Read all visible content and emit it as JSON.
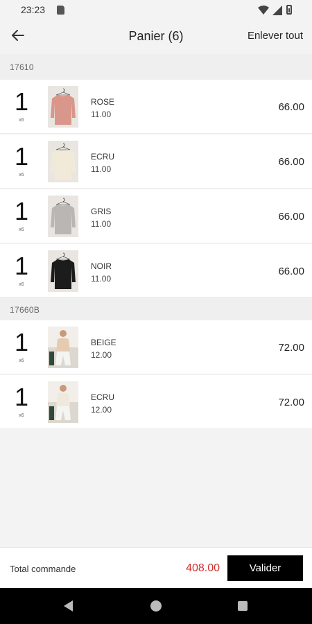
{
  "status_bar": {
    "time": "23:23"
  },
  "app_bar": {
    "title": "Panier (6)",
    "remove_all": "Enlever tout"
  },
  "groups": [
    {
      "ref": "17610"
    },
    {
      "ref": "17660B"
    }
  ],
  "items": [
    {
      "qty": "1",
      "qty_unit": "x6",
      "color": "ROSE",
      "unit_price": "11.00",
      "total": "66.00",
      "swatch": "#d9968a",
      "kind": "sweater"
    },
    {
      "qty": "1",
      "qty_unit": "x6",
      "color": "ECRU",
      "unit_price": "11.00",
      "total": "66.00",
      "swatch": "#f1ead8",
      "kind": "sweater"
    },
    {
      "qty": "1",
      "qty_unit": "x6",
      "color": "GRIS",
      "unit_price": "11.00",
      "total": "66.00",
      "swatch": "#b8b7b3",
      "kind": "sweater"
    },
    {
      "qty": "1",
      "qty_unit": "x6",
      "color": "NOIR",
      "unit_price": "11.00",
      "total": "66.00",
      "swatch": "#1c1c1c",
      "kind": "sweater"
    },
    {
      "qty": "1",
      "qty_unit": "x6",
      "color": "BEIGE",
      "unit_price": "12.00",
      "total": "72.00",
      "swatch": "#e6cbb3",
      "kind": "model"
    },
    {
      "qty": "1",
      "qty_unit": "x6",
      "color": "ECRU",
      "unit_price": "12.00",
      "total": "72.00",
      "swatch": "#efe8dc",
      "kind": "model"
    }
  ],
  "footer": {
    "total_label": "Total commande",
    "total_value": "408.00",
    "validate": "Valider"
  },
  "colors": {
    "accent_total": "#d32f2f",
    "button_bg": "#000000"
  }
}
